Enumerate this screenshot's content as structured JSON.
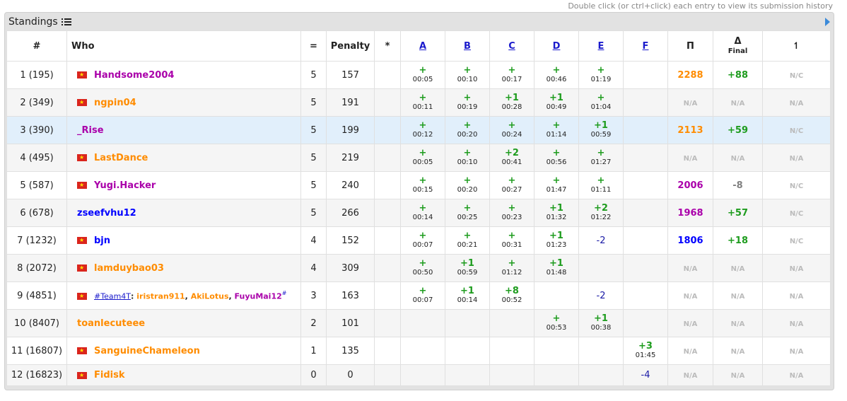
{
  "hint": "Double click (or ctrl+click) each entry to view its submission history",
  "panel_title": "Standings",
  "headers": {
    "rank": "#",
    "who": "Who",
    "solved": "=",
    "penalty": "Penalty",
    "hacks": "*",
    "problems": [
      "A",
      "B",
      "C",
      "D",
      "E",
      "F"
    ],
    "rating": "Π",
    "delta": "Δ",
    "delta_sub": "Final",
    "extra": "↿"
  },
  "colors": {
    "accepted": "#1e9c1e",
    "wrong": "#1a1aa6",
    "na": "#bbbbbb",
    "orange": "#ff8c00",
    "violet": "#a0a",
    "blue": "#0000ff",
    "gray": "#808080"
  },
  "rows": [
    {
      "rank": "1 (195)",
      "flag": true,
      "name": "Handsome2004",
      "name_color": "#a0a",
      "solved": "5",
      "penalty": "157",
      "hacks": "",
      "problems": [
        {
          "v": "+",
          "t": "00:05"
        },
        {
          "v": "+",
          "t": "00:10"
        },
        {
          "v": "+",
          "t": "00:17"
        },
        {
          "v": "+",
          "t": "00:46"
        },
        {
          "v": "+",
          "t": "01:19"
        },
        {
          "v": "",
          "t": ""
        }
      ],
      "rating": "2288",
      "rating_color": "#ff8c00",
      "delta": "+88",
      "delta_color": "#1e9c1e",
      "extra": "N/C",
      "highlight": false
    },
    {
      "rank": "2 (349)",
      "flag": true,
      "name": "ngpin04",
      "name_color": "#ff8c00",
      "solved": "5",
      "penalty": "191",
      "hacks": "",
      "problems": [
        {
          "v": "+",
          "t": "00:11"
        },
        {
          "v": "+",
          "t": "00:19"
        },
        {
          "v": "+1",
          "t": "00:28"
        },
        {
          "v": "+1",
          "t": "00:49"
        },
        {
          "v": "+",
          "t": "01:04"
        },
        {
          "v": "",
          "t": ""
        }
      ],
      "rating": "N/A",
      "rating_color": "#bbbbbb",
      "delta": "N/A",
      "delta_color": "#bbbbbb",
      "extra": "N/A",
      "highlight": false
    },
    {
      "rank": "3 (390)",
      "flag": false,
      "name": "_Rise",
      "name_color": "#a0a",
      "solved": "5",
      "penalty": "199",
      "hacks": "",
      "problems": [
        {
          "v": "+",
          "t": "00:12"
        },
        {
          "v": "+",
          "t": "00:20"
        },
        {
          "v": "+",
          "t": "00:24"
        },
        {
          "v": "+",
          "t": "01:14"
        },
        {
          "v": "+1",
          "t": "00:59"
        },
        {
          "v": "",
          "t": ""
        }
      ],
      "rating": "2113",
      "rating_color": "#ff8c00",
      "delta": "+59",
      "delta_color": "#1e9c1e",
      "extra": "N/C",
      "highlight": true
    },
    {
      "rank": "4 (495)",
      "flag": true,
      "name": "LastDance",
      "name_color": "#ff8c00",
      "solved": "5",
      "penalty": "219",
      "hacks": "",
      "problems": [
        {
          "v": "+",
          "t": "00:05"
        },
        {
          "v": "+",
          "t": "00:10"
        },
        {
          "v": "+2",
          "t": "00:41"
        },
        {
          "v": "+",
          "t": "00:56"
        },
        {
          "v": "+",
          "t": "01:27"
        },
        {
          "v": "",
          "t": ""
        }
      ],
      "rating": "N/A",
      "rating_color": "#bbbbbb",
      "delta": "N/A",
      "delta_color": "#bbbbbb",
      "extra": "N/A",
      "highlight": false
    },
    {
      "rank": "5 (587)",
      "flag": true,
      "name": "Yugi.Hacker",
      "name_color": "#a0a",
      "solved": "5",
      "penalty": "240",
      "hacks": "",
      "problems": [
        {
          "v": "+",
          "t": "00:15"
        },
        {
          "v": "+",
          "t": "00:20"
        },
        {
          "v": "+",
          "t": "00:27"
        },
        {
          "v": "+",
          "t": "01:47"
        },
        {
          "v": "+",
          "t": "01:11"
        },
        {
          "v": "",
          "t": ""
        }
      ],
      "rating": "2006",
      "rating_color": "#a0a",
      "delta": "-8",
      "delta_color": "#808080",
      "extra": "N/C",
      "highlight": false
    },
    {
      "rank": "6 (678)",
      "flag": false,
      "name": "zseefvhu12",
      "name_color": "#0000ff",
      "solved": "5",
      "penalty": "266",
      "hacks": "",
      "problems": [
        {
          "v": "+",
          "t": "00:14"
        },
        {
          "v": "+",
          "t": "00:25"
        },
        {
          "v": "+",
          "t": "00:23"
        },
        {
          "v": "+1",
          "t": "01:32"
        },
        {
          "v": "+2",
          "t": "01:22"
        },
        {
          "v": "",
          "t": ""
        }
      ],
      "rating": "1968",
      "rating_color": "#a0a",
      "delta": "+57",
      "delta_color": "#1e9c1e",
      "extra": "N/C",
      "highlight": false
    },
    {
      "rank": "7 (1232)",
      "flag": true,
      "name": "bjn",
      "name_color": "#0000ff",
      "solved": "4",
      "penalty": "152",
      "hacks": "",
      "problems": [
        {
          "v": "+",
          "t": "00:07"
        },
        {
          "v": "+",
          "t": "00:21"
        },
        {
          "v": "+",
          "t": "00:31"
        },
        {
          "v": "+1",
          "t": "01:23"
        },
        {
          "v": "-2",
          "t": "",
          "wa": true
        },
        {
          "v": "",
          "t": ""
        }
      ],
      "rating": "1806",
      "rating_color": "#0000ff",
      "delta": "+18",
      "delta_color": "#1e9c1e",
      "extra": "N/C",
      "highlight": false
    },
    {
      "rank": "8 (2072)",
      "flag": true,
      "name": "lamduybao03",
      "name_color": "#ff8c00",
      "solved": "4",
      "penalty": "309",
      "hacks": "",
      "problems": [
        {
          "v": "+",
          "t": "00:50"
        },
        {
          "v": "+1",
          "t": "00:59"
        },
        {
          "v": "+",
          "t": "01:12"
        },
        {
          "v": "+1",
          "t": "01:48"
        },
        {
          "v": "",
          "t": ""
        },
        {
          "v": "",
          "t": ""
        }
      ],
      "rating": "N/A",
      "rating_color": "#bbbbbb",
      "delta": "N/A",
      "delta_color": "#bbbbbb",
      "extra": "N/A",
      "highlight": false
    },
    {
      "rank": "9 (4851)",
      "flag": true,
      "team": true,
      "team_name": "#Team4T",
      "members": [
        {
          "name": "iristran911",
          "color": "#ff8c00"
        },
        {
          "name": "AkiLotus",
          "color": "#ff8c00"
        },
        {
          "name": "FuyuMai12",
          "color": "#a0a"
        }
      ],
      "team_mark": "#",
      "solved": "3",
      "penalty": "163",
      "hacks": "",
      "problems": [
        {
          "v": "+",
          "t": "00:07"
        },
        {
          "v": "+1",
          "t": "00:14"
        },
        {
          "v": "+8",
          "t": "00:52"
        },
        {
          "v": "",
          "t": ""
        },
        {
          "v": "-2",
          "t": "",
          "wa": true
        },
        {
          "v": "",
          "t": ""
        }
      ],
      "rating": "N/A",
      "rating_color": "#bbbbbb",
      "delta": "N/A",
      "delta_color": "#bbbbbb",
      "extra": "N/A",
      "highlight": false
    },
    {
      "rank": "10 (8407)",
      "flag": false,
      "name": "toanlecuteee",
      "name_color": "#ff8c00",
      "solved": "2",
      "penalty": "101",
      "hacks": "",
      "problems": [
        {
          "v": "",
          "t": ""
        },
        {
          "v": "",
          "t": ""
        },
        {
          "v": "",
          "t": ""
        },
        {
          "v": "+",
          "t": "00:53"
        },
        {
          "v": "+1",
          "t": "00:38"
        },
        {
          "v": "",
          "t": ""
        }
      ],
      "rating": "N/A",
      "rating_color": "#bbbbbb",
      "delta": "N/A",
      "delta_color": "#bbbbbb",
      "extra": "N/A",
      "highlight": false
    },
    {
      "rank": "11 (16807)",
      "flag": true,
      "name": "SanguineChameleon",
      "name_color": "#ff8c00",
      "solved": "1",
      "penalty": "135",
      "hacks": "",
      "problems": [
        {
          "v": "",
          "t": ""
        },
        {
          "v": "",
          "t": ""
        },
        {
          "v": "",
          "t": ""
        },
        {
          "v": "",
          "t": ""
        },
        {
          "v": "",
          "t": ""
        },
        {
          "v": "+3",
          "t": "01:45"
        }
      ],
      "rating": "N/A",
      "rating_color": "#bbbbbb",
      "delta": "N/A",
      "delta_color": "#bbbbbb",
      "extra": "N/A",
      "highlight": false
    },
    {
      "rank": "12 (16823)",
      "flag": true,
      "name": "Fidisk",
      "name_color": "#ff8c00",
      "solved": "0",
      "penalty": "0",
      "hacks": "",
      "problems": [
        {
          "v": "",
          "t": ""
        },
        {
          "v": "",
          "t": ""
        },
        {
          "v": "",
          "t": ""
        },
        {
          "v": "",
          "t": ""
        },
        {
          "v": "",
          "t": ""
        },
        {
          "v": "-4",
          "t": "",
          "wa": true
        }
      ],
      "rating": "N/A",
      "rating_color": "#bbbbbb",
      "delta": "N/A",
      "delta_color": "#bbbbbb",
      "extra": "N/A",
      "highlight": false
    }
  ]
}
